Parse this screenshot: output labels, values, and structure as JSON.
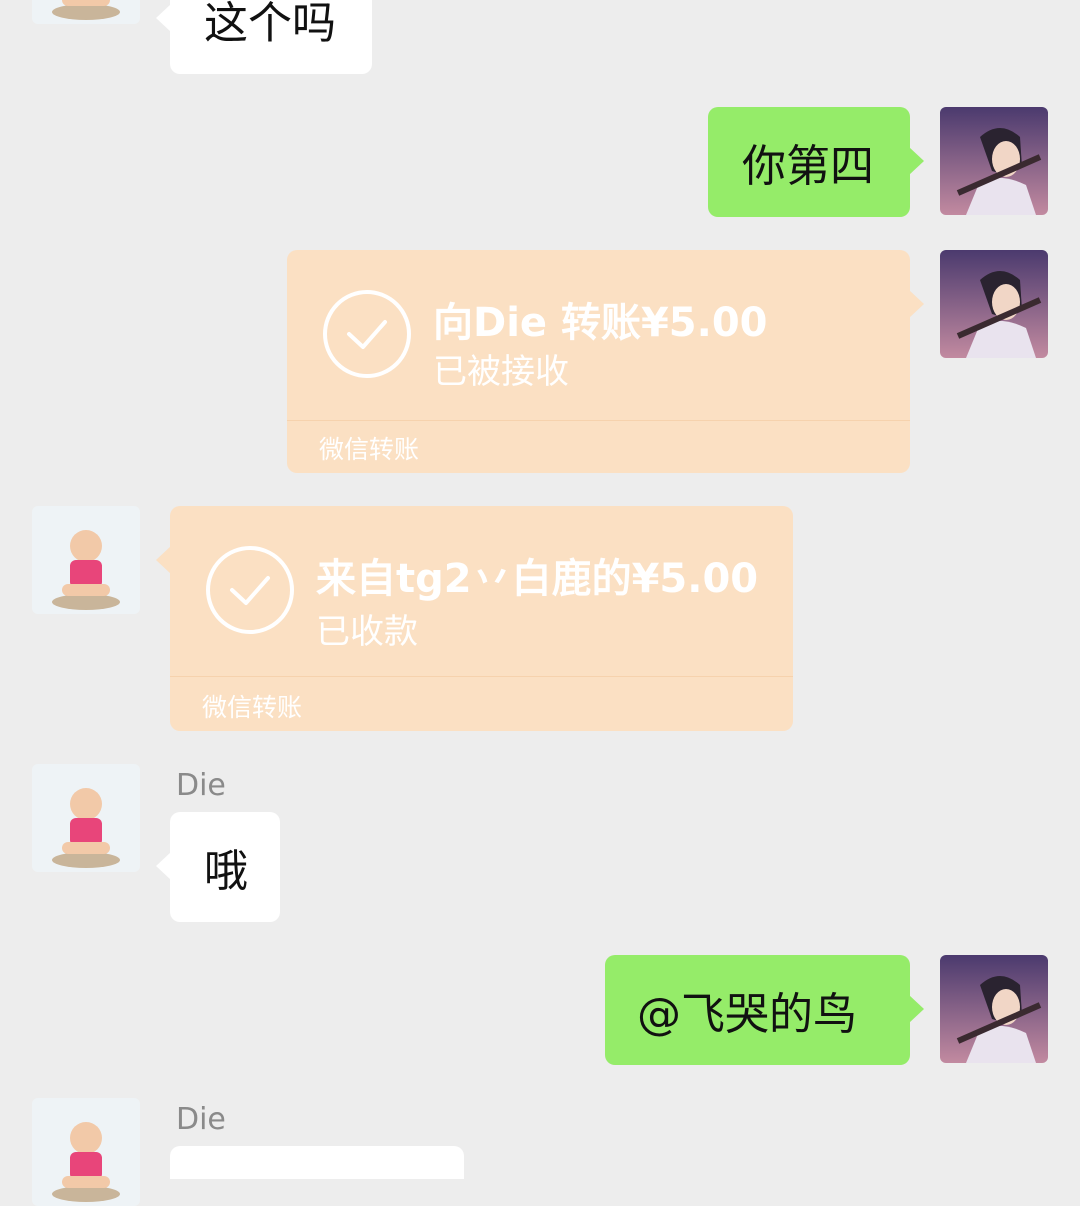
{
  "colors": {
    "background": "#ededed",
    "my_bubble": "#95ec69",
    "their_bubble": "#ffffff",
    "transfer_bubble": "#fbe0c3"
  },
  "messages": [
    {
      "side": "left",
      "type": "text",
      "text": "这个吗"
    },
    {
      "side": "right",
      "type": "text",
      "text": "你第四"
    },
    {
      "side": "right",
      "type": "transfer",
      "title": "向Die 转账¥5.00",
      "status": "已被接收",
      "footer": "微信转账",
      "icon": "check-circle-icon"
    },
    {
      "side": "left",
      "type": "transfer",
      "title": "来自tg2丷白鹿的¥5.00",
      "status": "已收款",
      "footer": "微信转账",
      "icon": "check-circle-icon"
    },
    {
      "side": "left",
      "type": "text",
      "sender": "Die",
      "text": "哦"
    },
    {
      "side": "right",
      "type": "text",
      "text": "@飞哭的鸟"
    },
    {
      "side": "left",
      "type": "text",
      "sender": "Die",
      "text": ""
    }
  ],
  "avatars": {
    "me": "anime-boy-avatar",
    "them": "baby-avatar"
  }
}
